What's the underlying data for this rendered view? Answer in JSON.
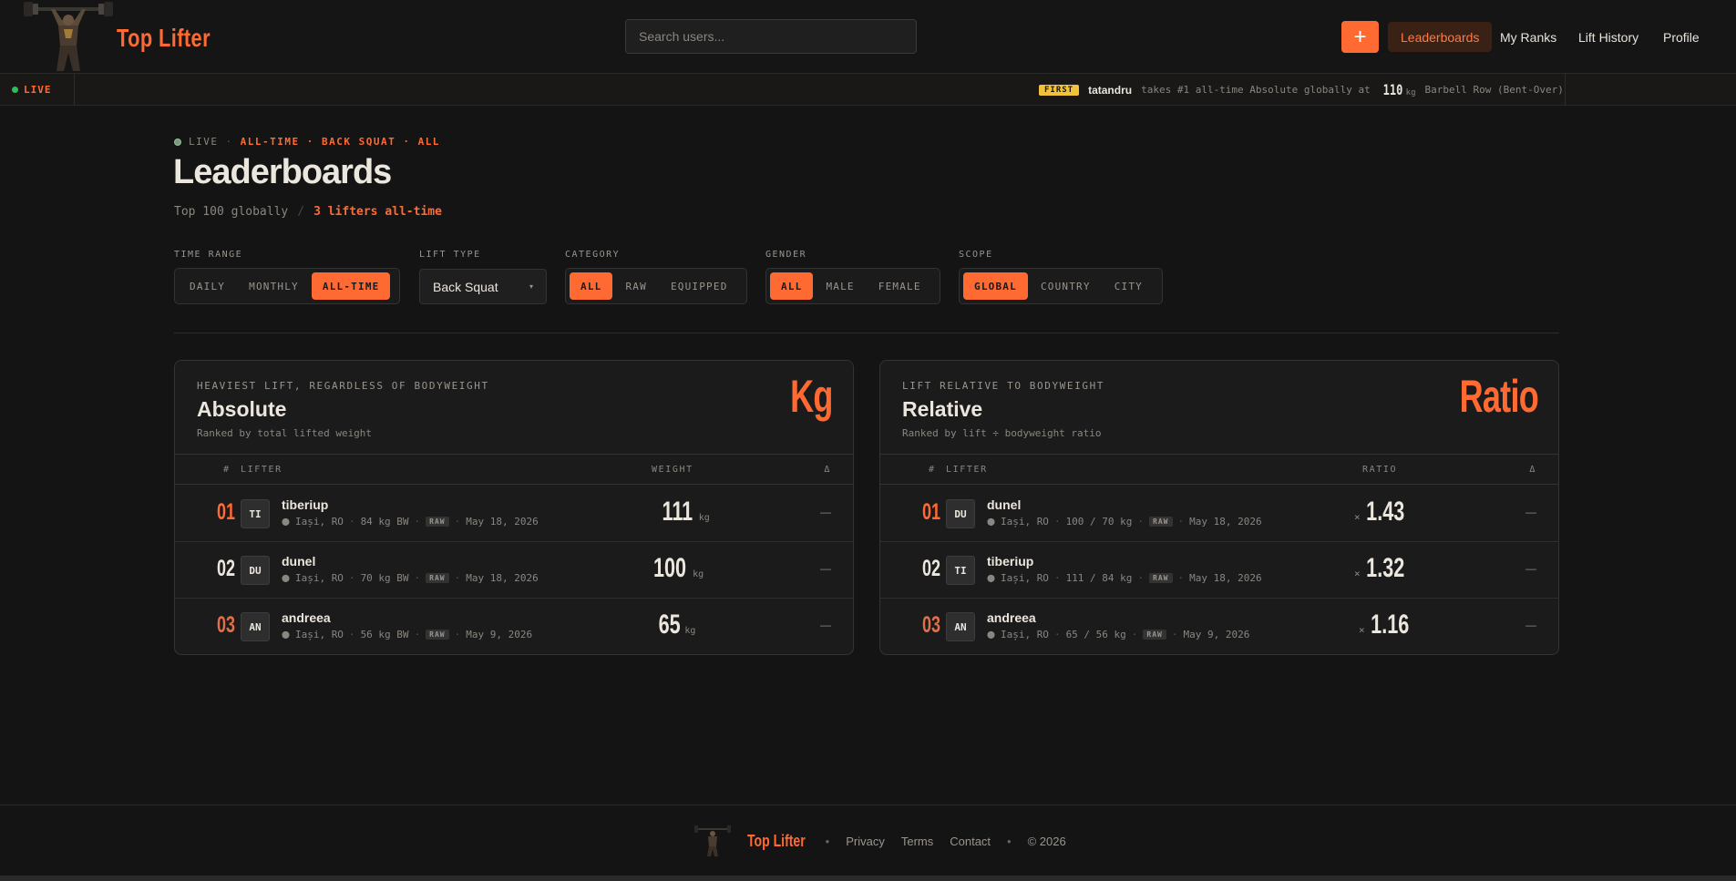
{
  "header": {
    "brand": "Top Lifter",
    "search_placeholder": "Search users...",
    "add_label": "+",
    "nav": [
      {
        "label": "Leaderboards",
        "active": true
      },
      {
        "label": "My Ranks",
        "active": false
      },
      {
        "label": "Lift History",
        "active": false
      },
      {
        "label": "Profile",
        "active": false
      }
    ]
  },
  "ticker": {
    "live_label": "LIVE",
    "badge": "FIRST",
    "user": "tatandru",
    "text": "takes #1 all-time Absolute globally at",
    "value": "110",
    "unit": "kg",
    "lift": "Barbell Row (Bent-Over)"
  },
  "page": {
    "crumb_live": "LIVE",
    "crumb_sep": "·",
    "crumb_selection": "ALL-TIME · BACK SQUAT · ALL",
    "title": "Leaderboards",
    "sub_muted": "Top 100 globally",
    "sub_sep": "/",
    "sub_count": "3 lifters all-time"
  },
  "filters": {
    "time_range": {
      "label": "TIME RANGE",
      "options": [
        "DAILY",
        "MONTHLY",
        "ALL-TIME"
      ],
      "selected": "ALL-TIME"
    },
    "lift_type": {
      "label": "LIFT TYPE",
      "value": "Back Squat"
    },
    "category": {
      "label": "CATEGORY",
      "options": [
        "ALL",
        "RAW",
        "EQUIPPED"
      ],
      "selected": "ALL"
    },
    "gender": {
      "label": "GENDER",
      "options": [
        "ALL",
        "MALE",
        "FEMALE"
      ],
      "selected": "ALL"
    },
    "scope": {
      "label": "SCOPE",
      "options": [
        "GLOBAL",
        "COUNTRY",
        "CITY"
      ],
      "selected": "GLOBAL"
    }
  },
  "absolute": {
    "eyebrow": "HEAVIEST LIFT, REGARDLESS OF BODYWEIGHT",
    "title": "Absolute",
    "subtitle": "Ranked by total lifted weight",
    "big": "Kg",
    "col_rank": "#",
    "col_lifter": "LIFTER",
    "col_metric": "WEIGHT",
    "col_delta": "Δ",
    "rows": [
      {
        "rank": "01",
        "initials": "TI",
        "name": "tiberiup",
        "location": "Iași, RO",
        "detail": "84 kg BW",
        "tag": "RAW",
        "date": "May 18, 2026",
        "value": "111",
        "unit": "kg",
        "delta": "—"
      },
      {
        "rank": "02",
        "initials": "DU",
        "name": "dunel",
        "location": "Iași, RO",
        "detail": "70 kg BW",
        "tag": "RAW",
        "date": "May 18, 2026",
        "value": "100",
        "unit": "kg",
        "delta": "—"
      },
      {
        "rank": "03",
        "initials": "AN",
        "name": "andreea",
        "location": "Iași, RO",
        "detail": "56 kg BW",
        "tag": "RAW",
        "date": "May 9, 2026",
        "value": "65",
        "unit": "kg",
        "delta": "—"
      }
    ]
  },
  "relative": {
    "eyebrow": "LIFT RELATIVE TO BODYWEIGHT",
    "title": "Relative",
    "subtitle": "Ranked by lift ÷ bodyweight ratio",
    "big": "Ratio",
    "col_rank": "#",
    "col_lifter": "LIFTER",
    "col_metric": "RATIO",
    "col_delta": "Δ",
    "rows": [
      {
        "rank": "01",
        "initials": "DU",
        "name": "dunel",
        "location": "Iași, RO",
        "detail": "100 / 70 kg",
        "tag": "RAW",
        "date": "May 18, 2026",
        "prefix": "×",
        "value": "1.43",
        "delta": "—"
      },
      {
        "rank": "02",
        "initials": "TI",
        "name": "tiberiup",
        "location": "Iași, RO",
        "detail": "111 / 84 kg",
        "tag": "RAW",
        "date": "May 18, 2026",
        "prefix": "×",
        "value": "1.32",
        "delta": "—"
      },
      {
        "rank": "03",
        "initials": "AN",
        "name": "andreea",
        "location": "Iași, RO",
        "detail": "65 / 56 kg",
        "tag": "RAW",
        "date": "May 9, 2026",
        "prefix": "×",
        "value": "1.16",
        "delta": "—"
      }
    ]
  },
  "footer": {
    "brand": "Top Lifter",
    "dot": "•",
    "links": [
      "Privacy",
      "Terms",
      "Contact"
    ],
    "copyright": "© 2026"
  },
  "colors": {
    "accent": "#ff6a33",
    "background": "#141414",
    "card": "#1b1b1b",
    "live_dot": "#2fbd5a",
    "first_badge": "#f2c33a"
  }
}
